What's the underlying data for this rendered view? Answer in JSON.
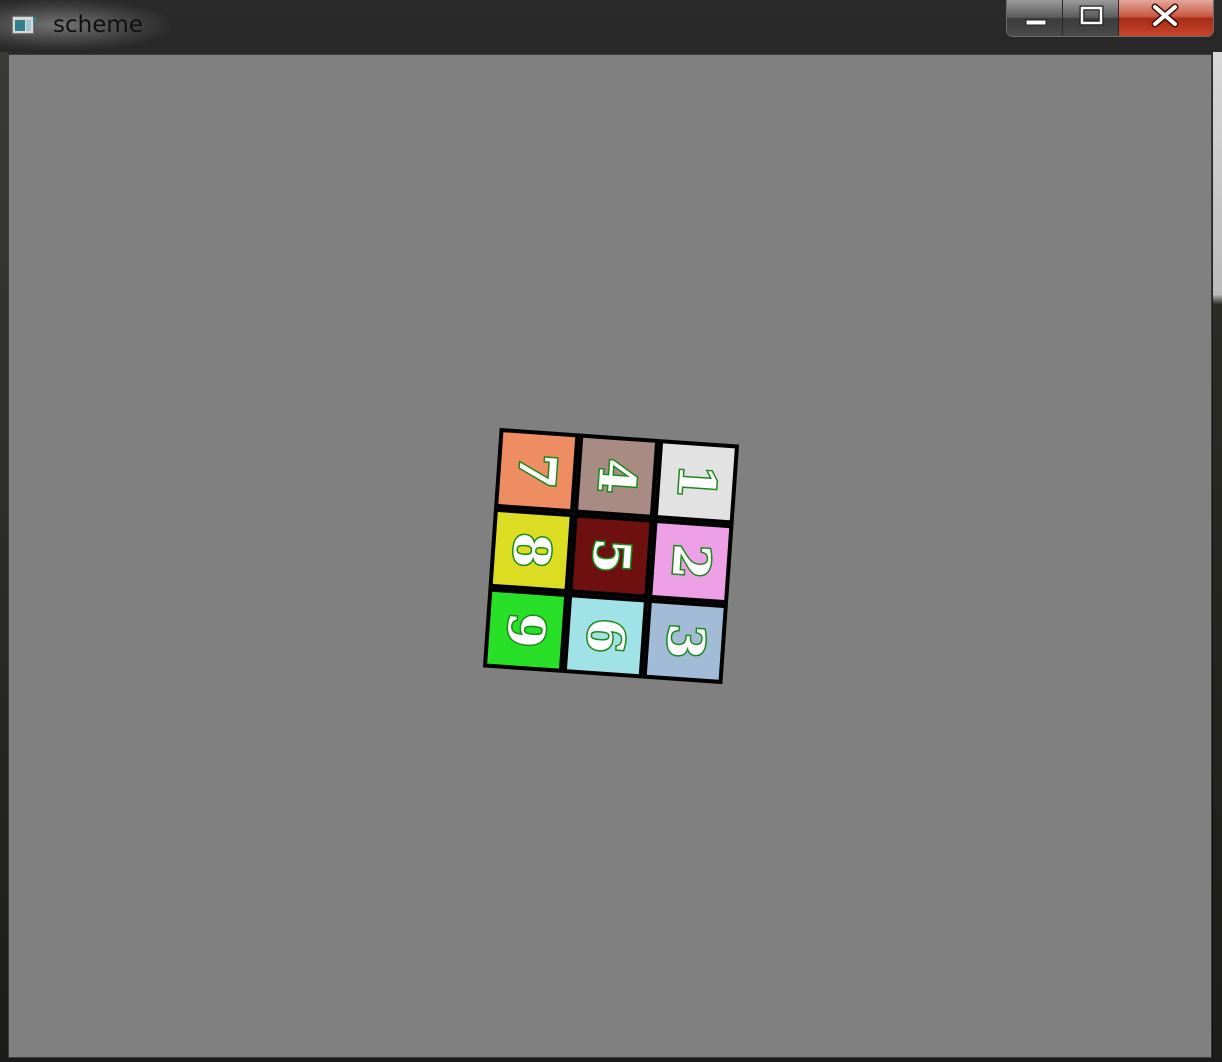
{
  "window": {
    "title": "scheme",
    "icon": "app-window-icon"
  },
  "caption_buttons": [
    {
      "name": "minimize",
      "icon": "minimize-icon"
    },
    {
      "name": "maximize",
      "icon": "maximize-icon"
    },
    {
      "name": "close",
      "icon": "close-icon"
    }
  ],
  "canvas": {
    "background_color": "#808080"
  },
  "puzzle": {
    "rotation_degrees": 94,
    "cell_order_note_free": true,
    "tiles": [
      {
        "label": "7",
        "color": "#ee8c62"
      },
      {
        "label": "4",
        "color": "#a88c84"
      },
      {
        "label": "1",
        "color": "#e2e2e2"
      },
      {
        "label": "8",
        "color": "#dcdc22"
      },
      {
        "label": "5",
        "color": "#6e1010"
      },
      {
        "label": "2",
        "color": "#eea0e6"
      },
      {
        "label": "9",
        "color": "#28e028"
      },
      {
        "label": "6",
        "color": "#a0e2e6"
      },
      {
        "label": "3",
        "color": "#a2bcd8"
      }
    ],
    "digit_fill": "#ffffff",
    "digit_outline": "#1a8a1a",
    "grid_line_color": "#000000"
  }
}
